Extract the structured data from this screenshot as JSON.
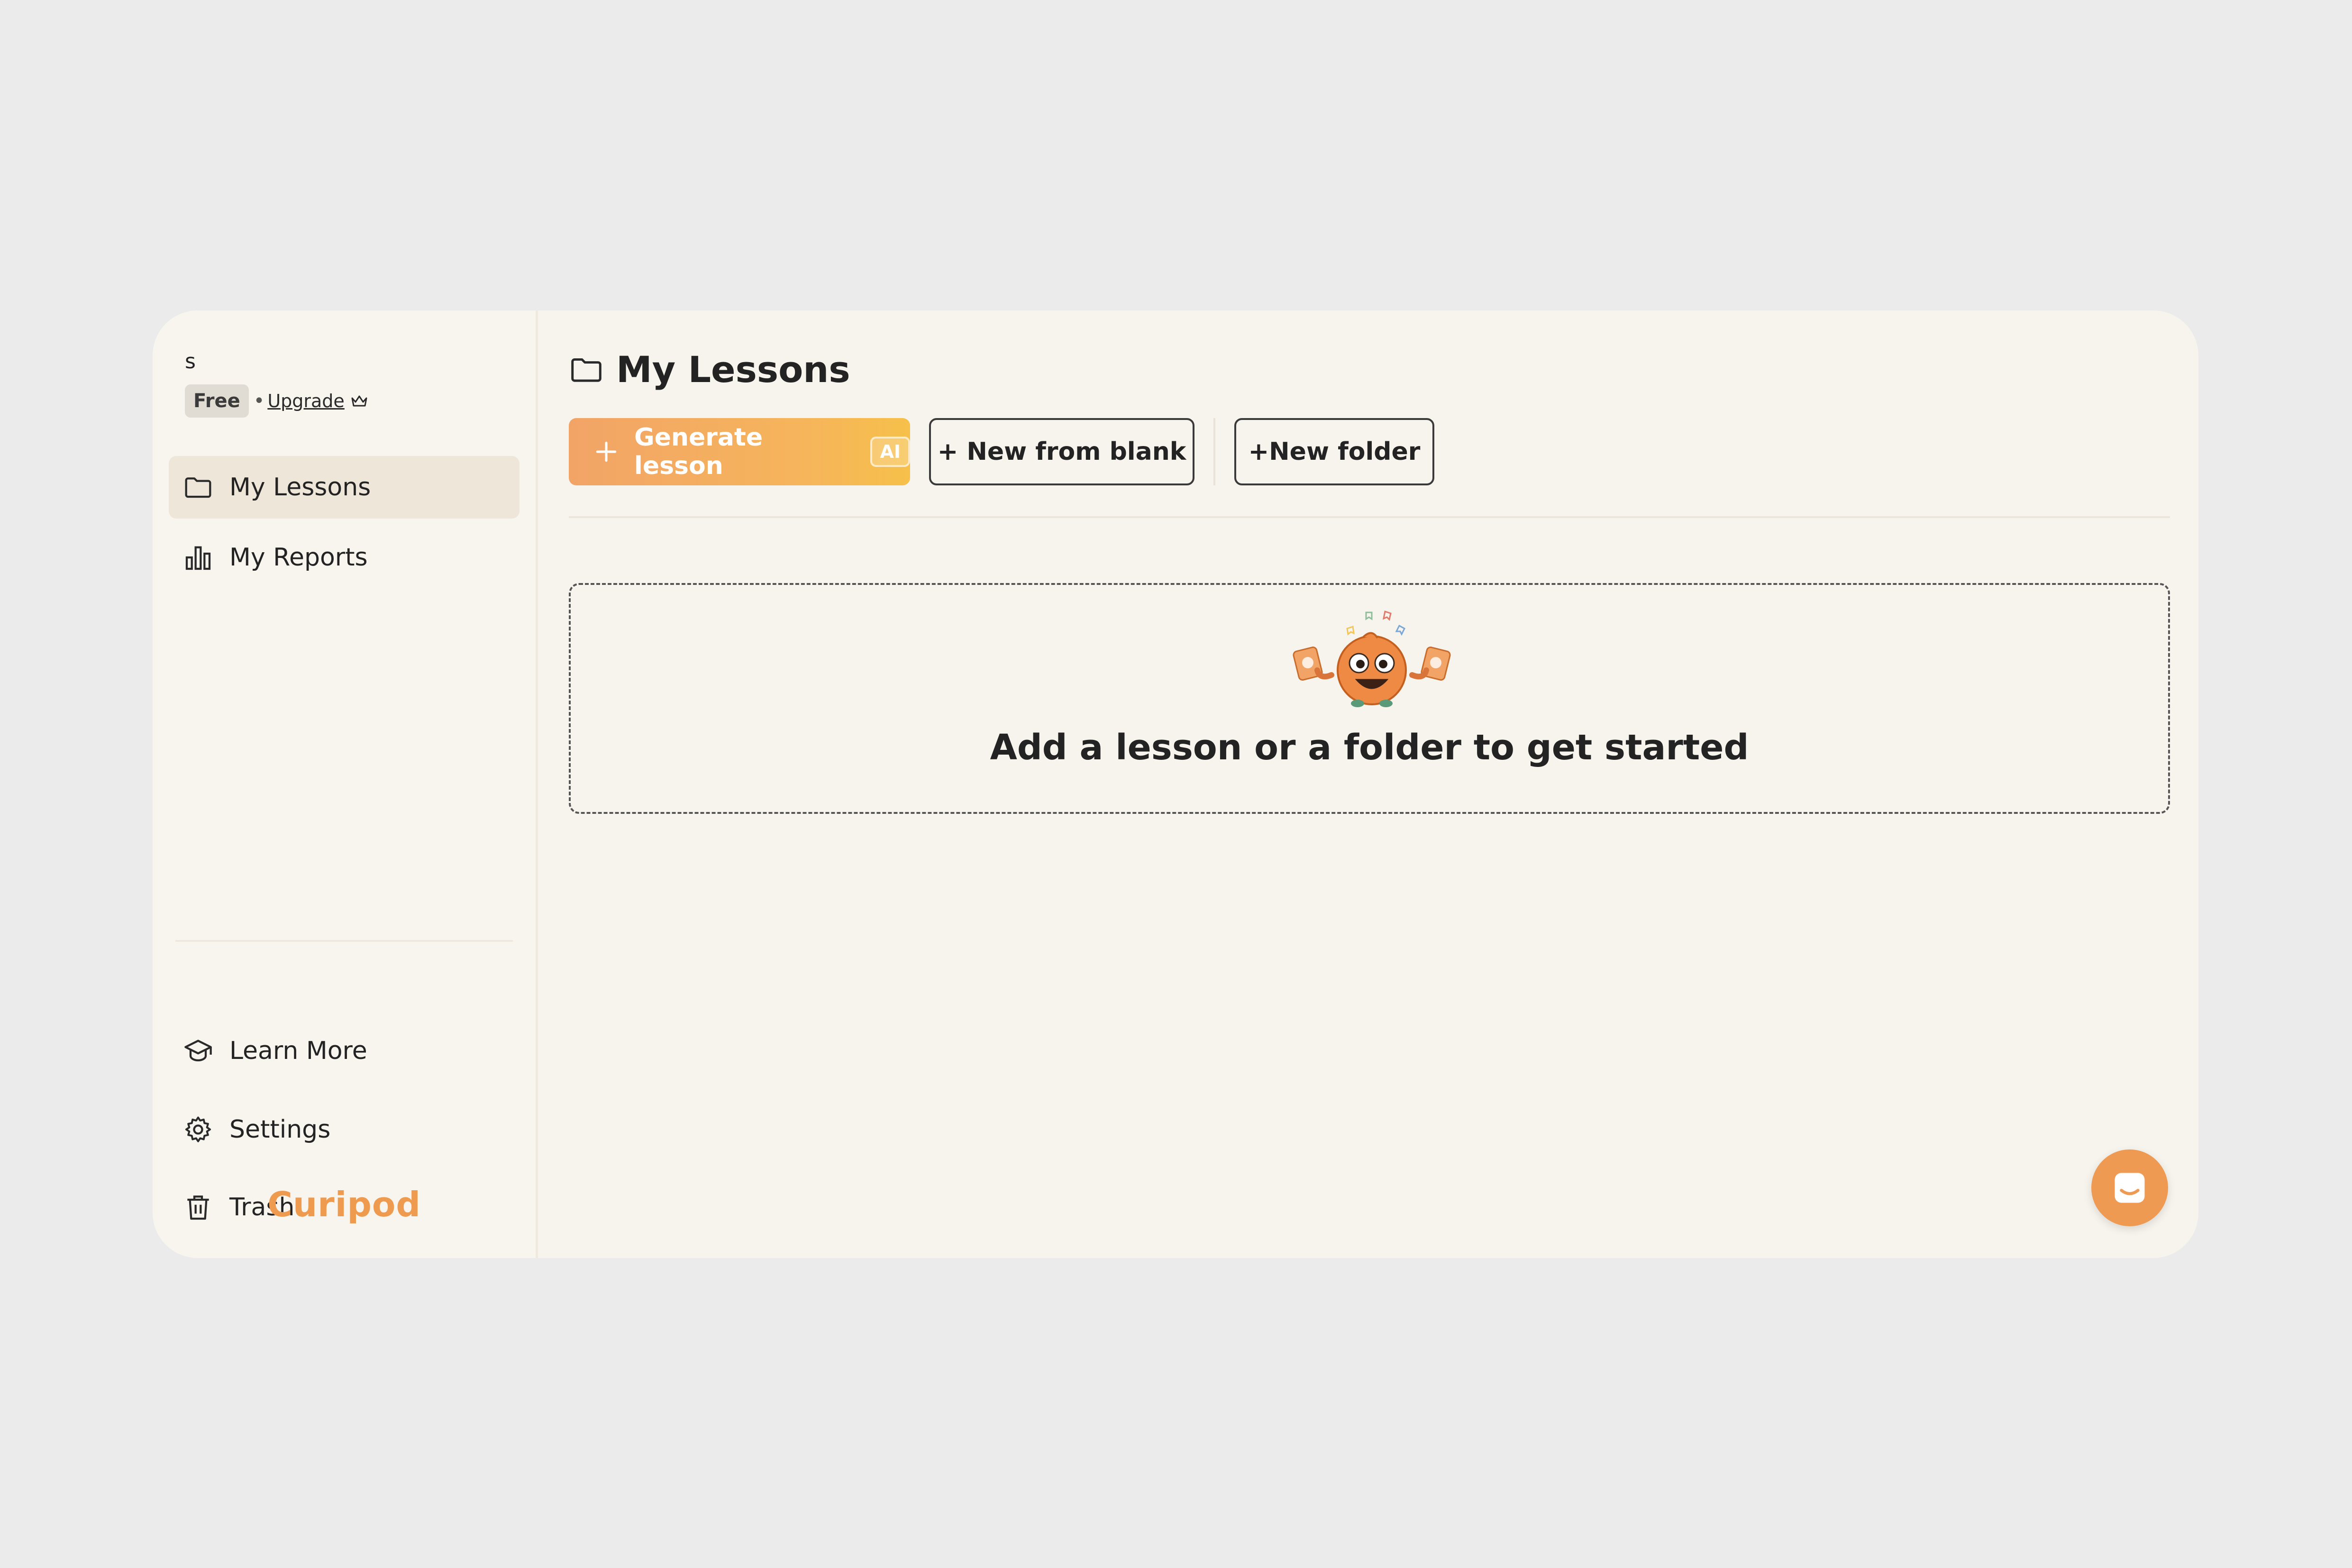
{
  "user": {
    "initial": "s",
    "plan": "Free",
    "separator": "•",
    "upgrade_label": "Upgrade"
  },
  "sidebar": {
    "items": [
      {
        "label": "My Lessons",
        "icon": "folder-icon",
        "active": true
      },
      {
        "label": "My Reports",
        "icon": "bar-chart-icon",
        "active": false
      }
    ],
    "bottom_items": [
      {
        "label": "Learn More",
        "icon": "graduation-cap-icon"
      },
      {
        "label": "Settings",
        "icon": "gear-icon"
      },
      {
        "label": "Trash",
        "icon": "trash-icon"
      }
    ],
    "brand": "Curipod"
  },
  "main": {
    "title": "My Lessons",
    "toolbar": {
      "generate_label": "Generate lesson",
      "ai_badge": "AI",
      "new_blank_label": "+ New from blank",
      "new_folder_label": "+New folder"
    },
    "empty_state": {
      "message": "Add a lesson or a folder to get started"
    }
  },
  "colors": {
    "accent": "#ef9a53",
    "background": "#ebebeb",
    "panel": "#f7f3ed",
    "active_item": "#efe6da"
  }
}
